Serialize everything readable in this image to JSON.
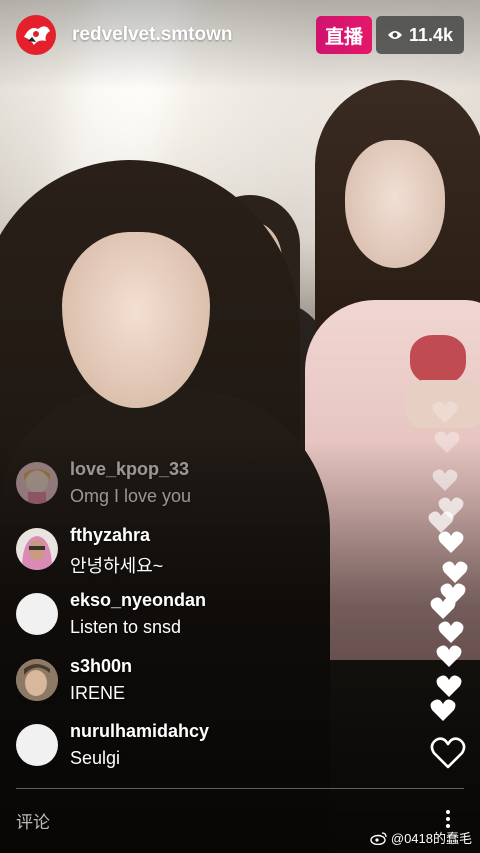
{
  "header": {
    "account_name": "redvelvet.smtown",
    "live_label": "直播",
    "viewer_count": "11.4k"
  },
  "comments": [
    {
      "username": "love_kpop_33",
      "text": "Omg I love you",
      "avatar": "pink-cartoon-avatar"
    },
    {
      "username": "fthyzahra",
      "text": "안녕하세요~",
      "avatar": "hijab-avatar"
    },
    {
      "username": "ekso_nyeondan",
      "text": "Listen to snsd",
      "avatar": "blank-avatar"
    },
    {
      "username": "s3h00n",
      "text": "IRENE",
      "avatar": "face-avatar"
    },
    {
      "username": "nurulhamidahcy",
      "text": "Seulgi",
      "avatar": "blank-avatar"
    }
  ],
  "bottom_bar": {
    "comment_placeholder": "评论"
  },
  "watermark": {
    "text": "@0418的蠢毛",
    "icon": "weibo-icon"
  },
  "colors": {
    "live_badge": "#d0136e",
    "viewer_badge": "#464646",
    "avatar_bg": "#e4202c"
  }
}
